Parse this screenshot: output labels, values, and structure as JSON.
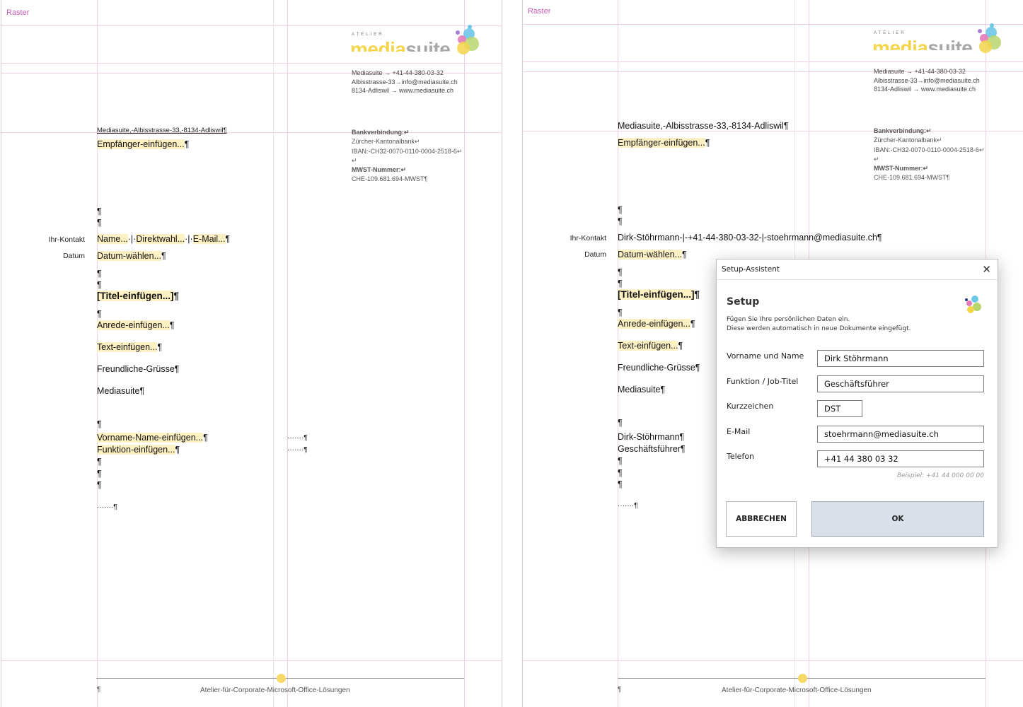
{
  "grid_label": "Raster",
  "company": {
    "brand_small": "ATELIER",
    "brand_word": "mediasuite",
    "contact_lines": [
      "Mediasuite   →   +41-44-380-03-32",
      "Albisstrasse-33→info@mediasuite.ch",
      "8134-Adliswil  →  www.mediasuite.ch"
    ],
    "bank_heading": "Bankverbindung:↵",
    "bank_name": "Zürcher-Kantonalbank↵",
    "iban": "IBAN:-CH32-0070-0110-0004-2518-6↵",
    "blank_return": "↵",
    "vat_heading": "MWST-Nummer:↵",
    "vat_number": "CHE-109.681.694-MWST¶"
  },
  "left_doc": {
    "sender_line": "Mediasuite,-Albisstrasse-33,-8134-Adliswil¶",
    "recipient": "Empfänger-einfügen...",
    "pilcrow": "¶",
    "contact_label": "Ihr-Kontakt",
    "contact_name": "Name...",
    "contact_sep1": "·|·",
    "contact_dial": "Direktwahl...",
    "contact_sep2": "·|·",
    "contact_mail": "E-Mail...",
    "date_label": "Datum",
    "date_value": "Datum-wählen...",
    "title": "[Titel-einfügen...]",
    "salutation": "Anrede-einfügen...",
    "body": "Text-einfügen...",
    "closing": "Freundliche-Grüsse¶",
    "company_sign": "Mediasuite¶",
    "signer_name": "Vorname-Name-einfügen...",
    "signer_function": "Funktion-einfügen...",
    "tab_leader_1": "·······¶",
    "tab_leader_2": "·······¶",
    "tab_leader_3": "·······¶",
    "footer_pilcrow": "¶",
    "footer_text": "Atelier-für-Corporate-Microsoft-Office-Lösungen"
  },
  "right_doc": {
    "sender_line": "Mediasuite,-Albisstrasse-33,-8134-Adliswil¶",
    "recipient": "Empfänger-einfügen...",
    "pilcrow": "¶",
    "contact_label": "Ihr-Kontakt",
    "contact_value": "Dirk-Stöhrmann-|-+41-44-380-03-32-|-stoehrmann@mediasuite.ch¶",
    "date_label": "Datum",
    "date_value": "Datum-wählen...",
    "title": "[Titel-einfügen...]",
    "salutation": "Anrede-einfügen...",
    "body": "Text-einfügen...",
    "closing": "Freundliche-Grüsse¶",
    "company_sign": "Mediasuite¶",
    "signer_name": "Dirk-Stöhrmann¶",
    "signer_function": "Geschäftsführer¶",
    "tab_leader": "·······¶",
    "footer_pilcrow": "¶",
    "footer_text": "Atelier-für-Corporate-Microsoft-Office-Lösungen"
  },
  "dialog": {
    "window_title": "Setup-Assistent",
    "close_icon": "close-icon",
    "heading": "Setup",
    "desc_line1": "Fügen Sie Ihre persönlichen Daten ein.",
    "desc_line2": "Diese werden automatisch in neue Dokumente eingefügt.",
    "fields": [
      {
        "label": "Vorname und Name",
        "value": "Dirk Stöhrmann"
      },
      {
        "label": "Funktion / Job-Titel",
        "value": "Geschäftsführer"
      },
      {
        "label": "Kurzzeichen",
        "value": "DST"
      },
      {
        "label": "E-Mail",
        "value": "stoehrmann@mediasuite.ch"
      },
      {
        "label": "Telefon",
        "value": "+41 44 380 03 32"
      }
    ],
    "phone_hint": "Beispiel:   +41 44 000 00 00",
    "cancel_label": "ABBRECHEN",
    "ok_label": "OK"
  },
  "colors": {
    "placeholder_highlight": "#fdf0c3",
    "grid_line": "#f2cde6",
    "raster_label": "#c75bb5",
    "ok_button": "#d9e0ea",
    "footer_dot": "#f7d96a"
  }
}
